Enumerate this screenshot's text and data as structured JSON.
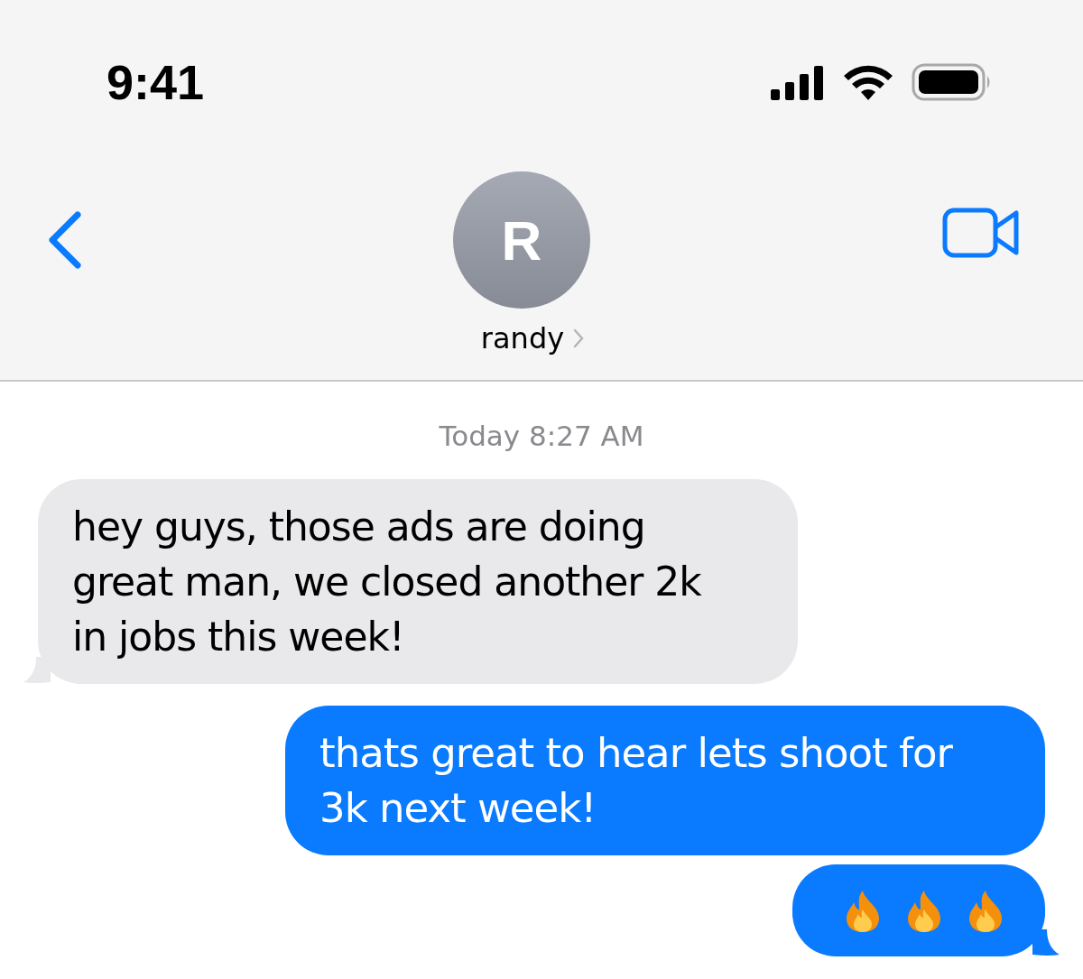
{
  "status_bar": {
    "time": "9:41"
  },
  "header": {
    "avatar_initial": "R",
    "contact_name": "randy"
  },
  "timestamp": "Today 8:27 AM",
  "messages": [
    {
      "kind": "received",
      "text": "hey guys, those ads are doing great man, we closed another 2k in jobs this week!"
    },
    {
      "kind": "sent",
      "text": "thats great to hear lets shoot for 3k next week!"
    },
    {
      "kind": "sent-icons",
      "icons": [
        {
          "kind": "fire"
        },
        {
          "kind": "fire"
        },
        {
          "kind": "fire"
        }
      ]
    }
  ]
}
